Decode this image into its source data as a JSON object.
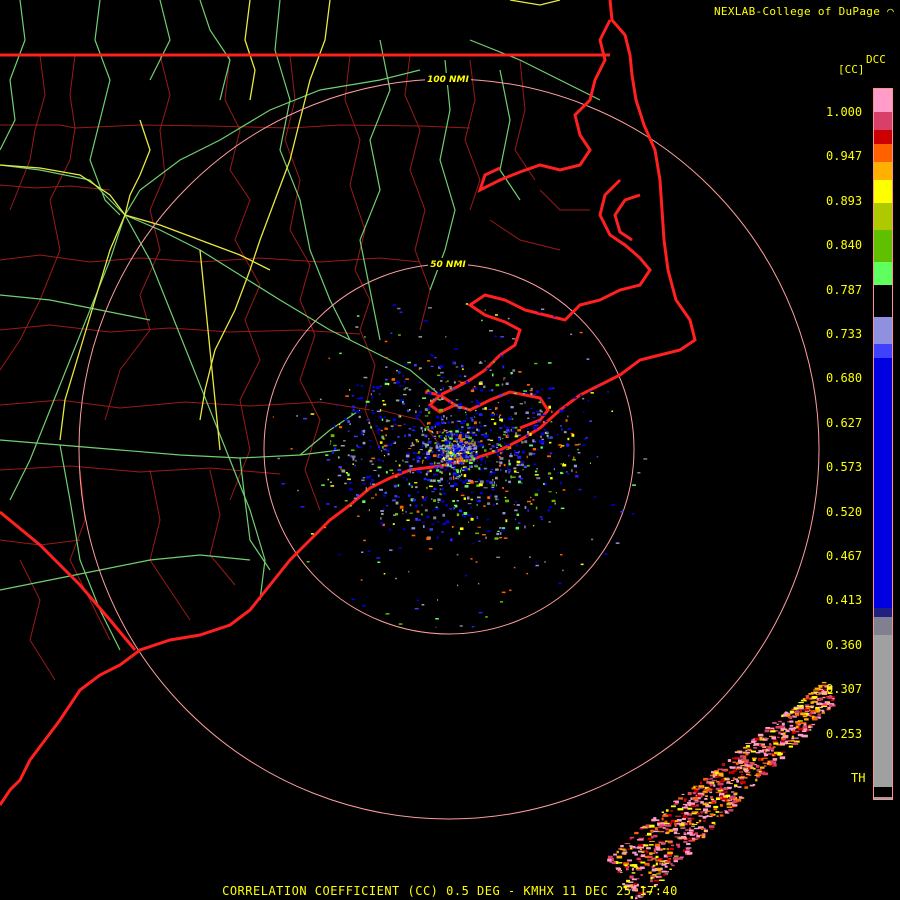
{
  "header": {
    "credit": "NEXLAB-College of DuPage"
  },
  "product": {
    "code": "DCC",
    "unit": "[CC]",
    "footer": "CORRELATION COEFFICIENT (CC) 0.5 DEG - KMHX 11 DEC 25 17:40"
  },
  "range_rings": [
    {
      "label": "100 NMI"
    },
    {
      "label": "50 NMI"
    }
  ],
  "colors": {
    "state_border": "#ff2020",
    "coastline": "#ff2020",
    "county_lines": "#9a1a1a",
    "roads_green": "#70d070",
    "roads_yellow": "#e8e840",
    "range_ring": "#ff9e9e",
    "label": "#ffff00"
  },
  "colorbar": {
    "ticks": [
      "1.000",
      "0.947",
      "0.893",
      "0.840",
      "0.787",
      "0.733",
      "0.680",
      "0.627",
      "0.573",
      "0.520",
      "0.467",
      "0.413",
      "0.360",
      "0.307",
      "0.253",
      "TH"
    ],
    "bands": [
      {
        "from": 1.0,
        "to": 0.975,
        "color": "#ff9cc8"
      },
      {
        "from": 0.975,
        "to": 0.955,
        "color": "#d8406a"
      },
      {
        "from": 0.955,
        "to": 0.94,
        "color": "#cc0000"
      },
      {
        "from": 0.94,
        "to": 0.92,
        "color": "#ff6000"
      },
      {
        "from": 0.92,
        "to": 0.9,
        "color": "#ffb000"
      },
      {
        "from": 0.9,
        "to": 0.875,
        "color": "#ffff00"
      },
      {
        "from": 0.875,
        "to": 0.845,
        "color": "#b0c800"
      },
      {
        "from": 0.845,
        "to": 0.81,
        "color": "#60c000"
      },
      {
        "from": 0.81,
        "to": 0.785,
        "color": "#60ff60"
      },
      {
        "from": 0.785,
        "to": 0.75,
        "color": "#000000"
      },
      {
        "from": 0.75,
        "to": 0.72,
        "color": "#9090e0"
      },
      {
        "from": 0.72,
        "to": 0.705,
        "color": "#4040ff"
      },
      {
        "from": 0.705,
        "to": 0.43,
        "color": "#0000e0"
      },
      {
        "from": 0.43,
        "to": 0.42,
        "color": "#202080"
      },
      {
        "from": 0.42,
        "to": 0.4,
        "color": "#808090"
      },
      {
        "from": 0.4,
        "to": 0.22,
        "color": "#a0a0a0"
      }
    ]
  }
}
